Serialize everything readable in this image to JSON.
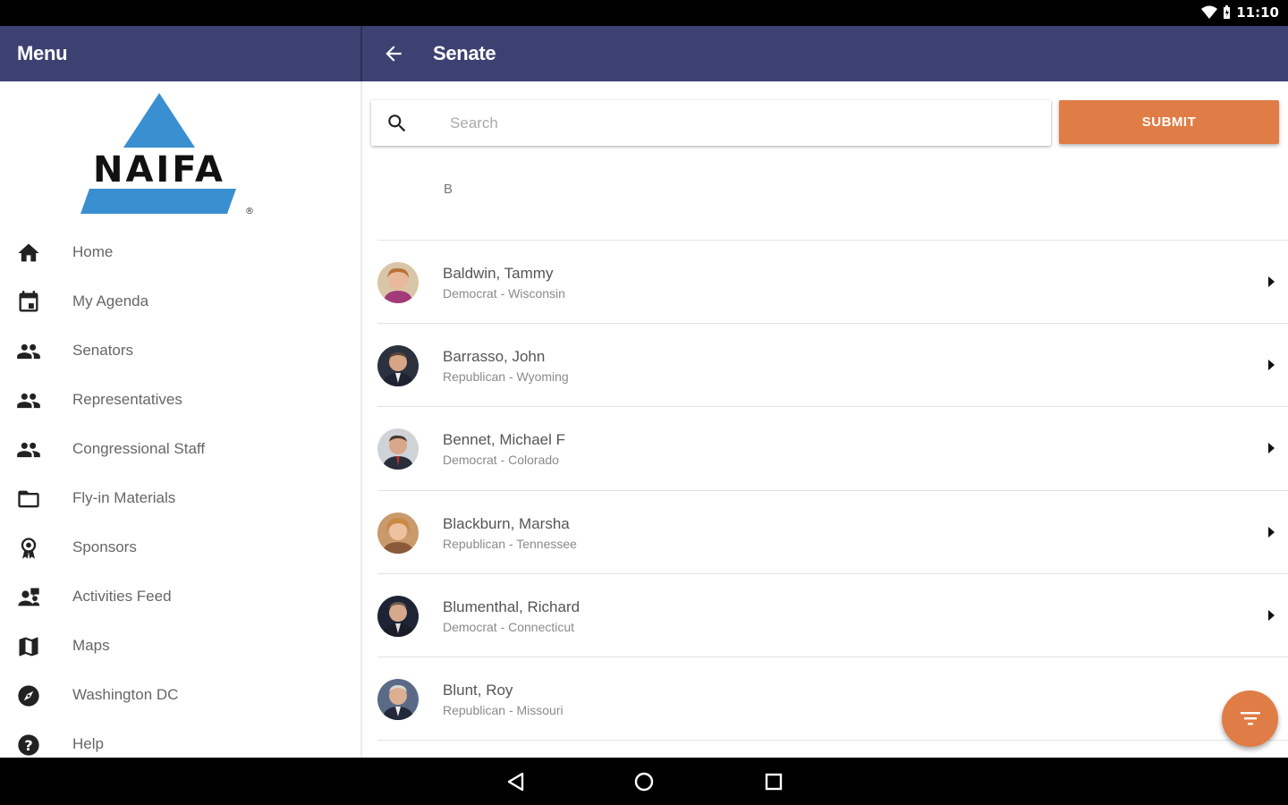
{
  "status_bar": {
    "time": "11:10"
  },
  "drawer": {
    "title": "Menu",
    "logo_text": "NAIFA",
    "items": [
      {
        "label": "Home",
        "icon": "home-icon"
      },
      {
        "label": "My Agenda",
        "icon": "calendar-icon"
      },
      {
        "label": "Senators",
        "icon": "people-icon"
      },
      {
        "label": "Representatives",
        "icon": "people-icon"
      },
      {
        "label": "Congressional Staff",
        "icon": "people-icon"
      },
      {
        "label": "Fly-in Materials",
        "icon": "folder-icon"
      },
      {
        "label": "Sponsors",
        "icon": "award-icon"
      },
      {
        "label": "Activities Feed",
        "icon": "group-chat-icon"
      },
      {
        "label": "Maps",
        "icon": "map-icon"
      },
      {
        "label": "Washington DC",
        "icon": "compass-icon"
      },
      {
        "label": "Help",
        "icon": "help-icon"
      }
    ]
  },
  "header": {
    "title": "Senate"
  },
  "search": {
    "placeholder": "Search",
    "value": "",
    "submit_label": "SUBMIT"
  },
  "list": {
    "section_letter": "B",
    "rows": [
      {
        "name": "Baldwin, Tammy",
        "detail": "Democrat - Wisconsin"
      },
      {
        "name": "Barrasso, John",
        "detail": "Republican - Wyoming"
      },
      {
        "name": "Bennet, Michael F",
        "detail": "Democrat - Colorado"
      },
      {
        "name": "Blackburn, Marsha",
        "detail": "Republican - Tennessee"
      },
      {
        "name": "Blumenthal, Richard",
        "detail": "Democrat - Connecticut"
      },
      {
        "name": "Blunt, Roy",
        "detail": "Republican - Missouri"
      }
    ]
  },
  "colors": {
    "app_bar": "#3d4171",
    "accent": "#e07c45",
    "logo_blue": "#3a8fd0"
  }
}
